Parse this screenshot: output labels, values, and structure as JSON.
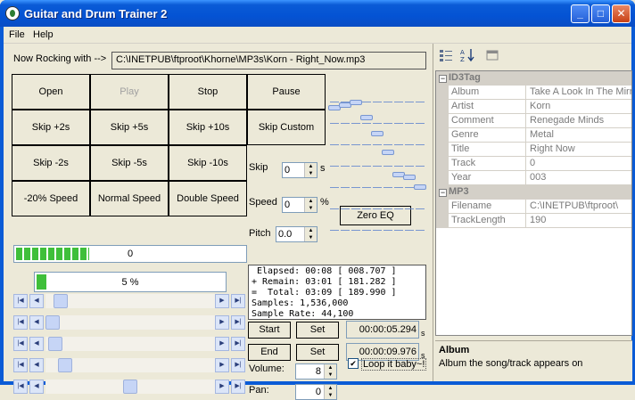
{
  "window": {
    "title": "Guitar and Drum Trainer 2"
  },
  "menu": [
    "File",
    "Help"
  ],
  "file_row": {
    "label": "Now Rocking with -->",
    "path": "C:\\INETPUB\\ftproot\\Khorne\\MP3s\\Korn - Right_Now.mp3"
  },
  "buttons": {
    "open": "Open",
    "play": "Play",
    "stop": "Stop",
    "pause": "Pause",
    "skip_p2": "Skip +2s",
    "skip_p5": "Skip +5s",
    "skip_p10": "Skip +10s",
    "skip_custom": "Skip Custom",
    "skip_m2": "Skip -2s",
    "skip_m5": "Skip -5s",
    "skip_m10": "Skip -10s",
    "speed_m20": "-20% Speed",
    "normal_speed": "Normal Speed",
    "double_speed": "Double Speed",
    "zero_eq": "Zero EQ",
    "start": "Start",
    "set1": "Set",
    "end": "End",
    "set2": "Set"
  },
  "controls": {
    "skip_label": "Skip",
    "skip_value": "0",
    "skip_unit": "s",
    "speed_label": "Speed",
    "speed_value": "0",
    "speed_unit": "%",
    "pitch_label": "Pitch",
    "pitch_value": "0.0",
    "volume_label": "Volume:",
    "volume_value": "8",
    "pan_label": "Pan:",
    "pan_value": "0",
    "loop_label": "Loop it baby~!",
    "loop_checked": true,
    "start_time": "00:00:05.294",
    "end_time": "00:00:09.976",
    "time_unit": "s"
  },
  "progress": {
    "level_value": "0",
    "level_fraction": 0.32,
    "position_text": "5 %",
    "position_fraction": 0.05
  },
  "info": {
    "line1": " Elapsed: 00:08 [ 008.707 ]",
    "line2": "+ Remain: 03:01 [ 181.282 ]",
    "line3": "=  Total: 03:09 [ 189.990 ]",
    "line4": "Samples: 1,536,000",
    "line5": "Sample Rate: 44,100"
  },
  "scrollbars": [
    0.05,
    0.0,
    0.02,
    0.08,
    0.5
  ],
  "eq_levels": [
    0.04,
    0.02,
    0.0,
    0.12,
    0.25,
    0.4,
    0.58,
    0.6,
    0.68,
    0.7
  ],
  "property_grid": {
    "cat1": "ID3Tag",
    "rows1": [
      {
        "k": "Album",
        "v": "Take A Look In The Mirror"
      },
      {
        "k": "Artist",
        "v": "Korn"
      },
      {
        "k": "Comment",
        "v": "Renegade Minds"
      },
      {
        "k": "Genre",
        "v": "Metal"
      },
      {
        "k": "Title",
        "v": "Right Now"
      },
      {
        "k": "Track",
        "v": "0"
      },
      {
        "k": "Year",
        "v": "003"
      }
    ],
    "cat2": "MP3",
    "rows2": [
      {
        "k": "Filename",
        "v": "C:\\INETPUB\\ftproot\\"
      },
      {
        "k": "TrackLength",
        "v": "190"
      }
    ],
    "desc_title": "Album",
    "desc_text": "Album the song/track appears on"
  }
}
